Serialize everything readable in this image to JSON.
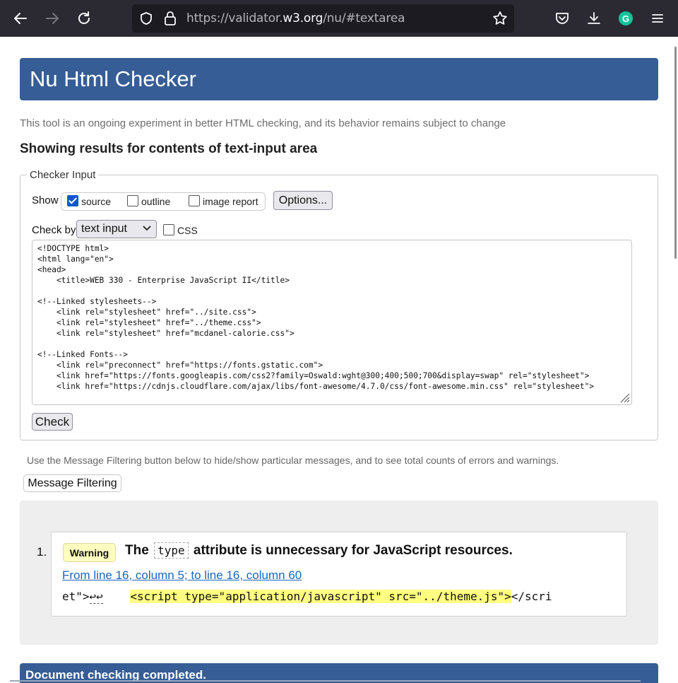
{
  "browser": {
    "url_prefix": "https://validator.",
    "url_host": "w3.org",
    "url_suffix": "/nu/#textarea",
    "grammarly_letter": "G"
  },
  "page": {
    "title": "Nu Html Checker",
    "tagline": "This tool is an ongoing experiment in better HTML checking, and its behavior remains subject to change",
    "results_heading": "Showing results for contents of text-input area"
  },
  "checker": {
    "legend": "Checker Input",
    "show_label": "Show",
    "options": [
      {
        "label": "source",
        "checked": true
      },
      {
        "label": "outline",
        "checked": false
      },
      {
        "label": "image report",
        "checked": false
      }
    ],
    "options_button": "Options...",
    "checkby_label": "Check by",
    "checkby_value": "text input",
    "css_label": "CSS",
    "css_checked": false,
    "check_button": "Check",
    "source_lines": [
      "<!DOCTYPE html>",
      "<html lang=\"en\">",
      "<head>",
      "    <title>WEB 330 - Enterprise JavaScript II</title>",
      "",
      "<!--Linked stylesheets-->",
      "    <link rel=\"stylesheet\" href=\"../site.css\">",
      "    <link rel=\"stylesheet\" href=\"../theme.css\">",
      "    <link rel=\"stylesheet\" href=\"mcdanel-calorie.css\">",
      "",
      "<!--Linked Fonts-->",
      "    <link rel=\"preconnect\" href=\"https://fonts.gstatic.com\">",
      "    <link href=\"https://fonts.googleapis.com/css2?family=Oswald:wght@300;400;500;700&display=swap\" rel=\"stylesheet\">",
      "    <link href=\"https://cdnjs.cloudflare.com/ajax/libs/font-awesome/4.7.0/css/font-awesome.min.css\" rel=\"stylesheet\">"
    ]
  },
  "filter": {
    "hint": "Use the Message Filtering button below to hide/show particular messages, and to see total counts of errors and warnings.",
    "button": "Message Filtering"
  },
  "messages": [
    {
      "number": "1.",
      "type": "Warning",
      "text_before": "The",
      "code": "type",
      "text_after": "attribute is unnecessary for JavaScript resources.",
      "location": "From line 16, column 5; to line 16, column 60",
      "extract_before": "et\">",
      "extract_nl": "↩↩",
      "extract_gap": "    ",
      "extract_highlight": "<script type=\"application/javascript\" src=\"../theme.js\">",
      "extract_after": "</scri"
    }
  ],
  "status": {
    "done": "Document checking completed."
  },
  "colors": {
    "brand": "#365d95",
    "warning_badge": "#ffffc0",
    "highlight": "#ffff80",
    "link": "#1a66b8"
  }
}
